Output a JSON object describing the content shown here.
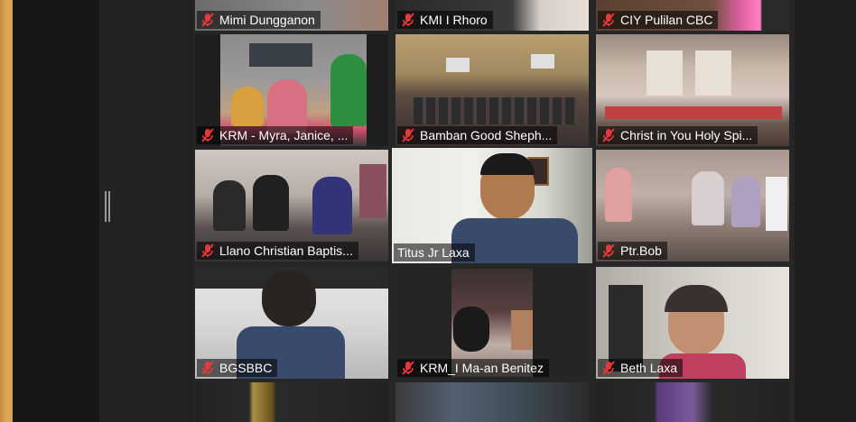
{
  "colors": {
    "active_speaker_border": "#c9e04a",
    "muted_icon": "#e8383b",
    "nameplate_text": "#ffffff"
  },
  "icons": {
    "muted": "microphone-muted-icon",
    "splitter": "drag-handle-icon"
  },
  "participants": [
    {
      "name": "Mimi Dungganon",
      "muted": true
    },
    {
      "name": "KMI I Rhoro",
      "muted": true
    },
    {
      "name": "CIY Pulilan CBC",
      "muted": true
    },
    {
      "name": "KRM - Myra, Janice, ...",
      "muted": true
    },
    {
      "name": "Bamban Good Sheph...",
      "muted": true
    },
    {
      "name": "Christ in You Holy Spi...",
      "muted": true
    },
    {
      "name": "Llano Christian Baptis...",
      "muted": true
    },
    {
      "name": "Titus Jr Laxa",
      "muted": false,
      "active_speaker": true
    },
    {
      "name": "Ptr.Bob",
      "muted": true
    },
    {
      "name": "BGSBBC",
      "muted": true
    },
    {
      "name": "KRM_I Ma-an Benitez",
      "muted": true
    },
    {
      "name": "Beth Laxa",
      "muted": true
    },
    {
      "name": "",
      "muted": false
    },
    {
      "name": "",
      "muted": false
    },
    {
      "name": "",
      "muted": false
    }
  ]
}
